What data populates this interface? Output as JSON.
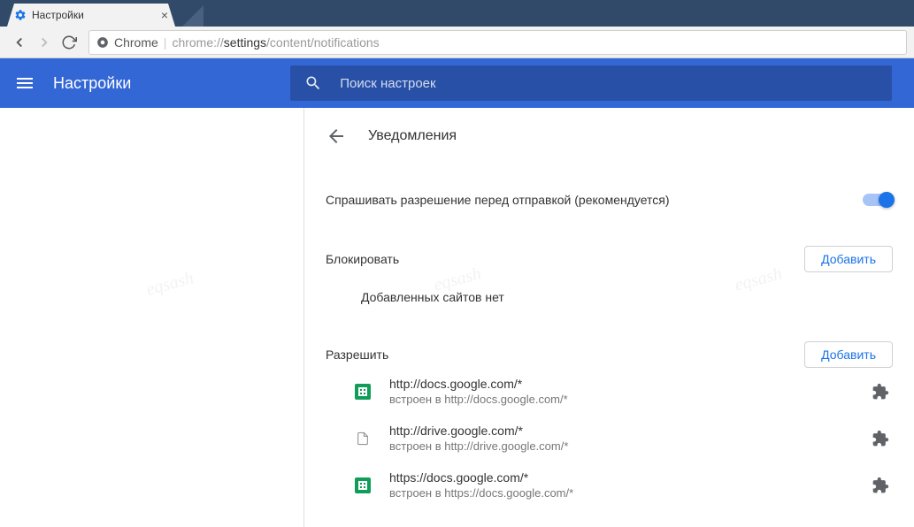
{
  "browser": {
    "tab_title": "Настройки",
    "url_label": "Chrome",
    "url_scheme": "chrome://",
    "url_bold": "settings",
    "url_rest": "/content/notifications"
  },
  "header": {
    "title": "Настройки",
    "search_placeholder": "Поиск настроек"
  },
  "page": {
    "title": "Уведомления",
    "main_toggle_label": "Спрашивать разрешение перед отправкой (рекомендуется)"
  },
  "block_section": {
    "title": "Блокировать",
    "add_label": "Добавить",
    "empty": "Добавленных сайтов нет"
  },
  "allow_section": {
    "title": "Разрешить",
    "add_label": "Добавить",
    "items": [
      {
        "url": "http://docs.google.com/*",
        "sub": "встроен в http://docs.google.com/*",
        "icon": "sheets"
      },
      {
        "url": "http://drive.google.com/*",
        "sub": "встроен в http://drive.google.com/*",
        "icon": "doc"
      },
      {
        "url": "https://docs.google.com/*",
        "sub": "встроен в https://docs.google.com/*",
        "icon": "sheets"
      }
    ]
  },
  "watermark": "eqsash"
}
